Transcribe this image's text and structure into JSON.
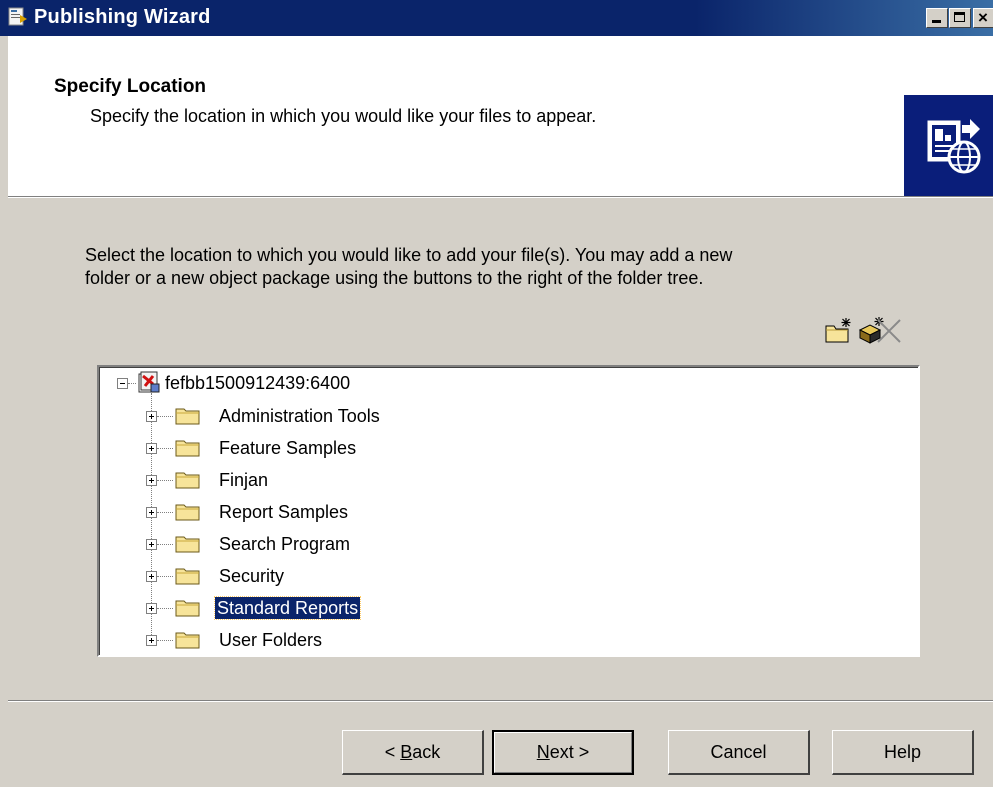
{
  "window": {
    "title": "Publishing Wizard",
    "controls": [
      "minimize-icon",
      "maximize-icon",
      "close-icon"
    ]
  },
  "header": {
    "title": "Specify Location",
    "subtitle": "Specify the location in which you would like your files to appear.",
    "icon": "publish-globe-icon"
  },
  "instructions": {
    "line1": "Select the location to which you would like to add your file(s).  You may add a new",
    "line2": "folder or a new object package using the buttons to the right of the folder tree."
  },
  "toolbar": {
    "new_folder_icon": "new-folder-icon",
    "new_package_icon": "new-object-package-icon",
    "delete_icon": "delete-icon"
  },
  "tree": {
    "root": {
      "label": "fefbb1500912439:6400",
      "expanded": true
    },
    "items": [
      {
        "label": "Administration Tools",
        "selected": false
      },
      {
        "label": "Feature Samples",
        "selected": false
      },
      {
        "label": "Finjan",
        "selected": false
      },
      {
        "label": "Report Samples",
        "selected": false
      },
      {
        "label": "Search Program",
        "selected": false
      },
      {
        "label": "Security",
        "selected": false
      },
      {
        "label": "Standard Reports",
        "selected": true
      },
      {
        "label": "User Folders",
        "selected": false
      }
    ]
  },
  "buttons": {
    "back": {
      "pre": "< ",
      "mnemonic": "B",
      "post": "ack"
    },
    "next": {
      "mnemonic": "N",
      "post": "ext >"
    },
    "cancel": "Cancel",
    "help": "Help"
  },
  "colors": {
    "titlebar": "#0a246a",
    "selection": "#0a246a",
    "face": "#d4d0c8",
    "folder": "#f7e49a"
  }
}
